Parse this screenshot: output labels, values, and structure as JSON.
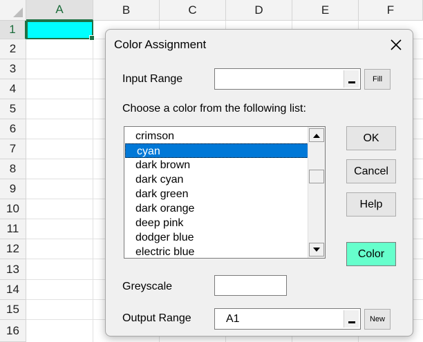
{
  "spreadsheet": {
    "columns": [
      "A",
      "B",
      "C",
      "D",
      "E",
      "F"
    ],
    "rows": [
      "1",
      "2",
      "3",
      "4",
      "5",
      "6",
      "7",
      "8",
      "9",
      "10",
      "11",
      "12",
      "13",
      "14",
      "15",
      "16"
    ],
    "active_cell_color": "#00ffff"
  },
  "dialog": {
    "title": "Color Assignment",
    "input_range": {
      "label": "Input Range",
      "value": "",
      "button": "Fill"
    },
    "list_prompt": "Choose a color from the following list:",
    "color_list": {
      "items": [
        "crimson",
        "cyan",
        "dark brown",
        "dark cyan",
        "dark green",
        "dark orange",
        "deep pink",
        "dodger blue",
        "electric blue"
      ],
      "selected": "cyan"
    },
    "buttons": {
      "ok": "OK",
      "cancel": "Cancel",
      "help": "Help",
      "color": "Color"
    },
    "greyscale": {
      "label": "Greyscale",
      "value": ""
    },
    "output_range": {
      "label": "Output Range",
      "value": "A1",
      "button": "New"
    },
    "colors": {
      "selection": "#0078d7",
      "color_button": "#66ffcc"
    }
  }
}
